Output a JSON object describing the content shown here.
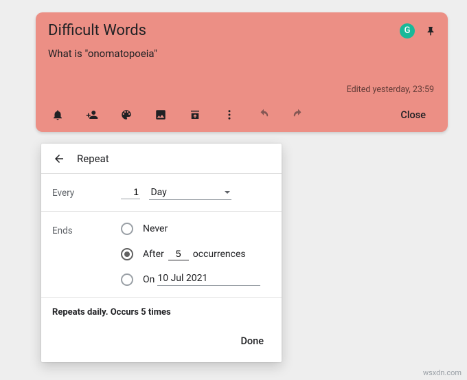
{
  "note": {
    "title": "Difficult Words",
    "body": "What is \"onomatopoeia\"",
    "edited": "Edited yesterday, 23:59",
    "close_label": "Close"
  },
  "header": {
    "badge_letter": "G"
  },
  "popup": {
    "title": "Repeat",
    "every_label": "Every",
    "interval_value": "1",
    "unit_label": "Day",
    "ends_label": "Ends",
    "never_label": "Never",
    "after_prefix": "After",
    "after_value": "5",
    "after_suffix": "occurrences",
    "on_prefix": "On",
    "on_date": "10 Jul 2021",
    "summary": "Repeats daily. Occurs 5 times",
    "done_label": "Done"
  },
  "watermark": "wsxdn.com"
}
